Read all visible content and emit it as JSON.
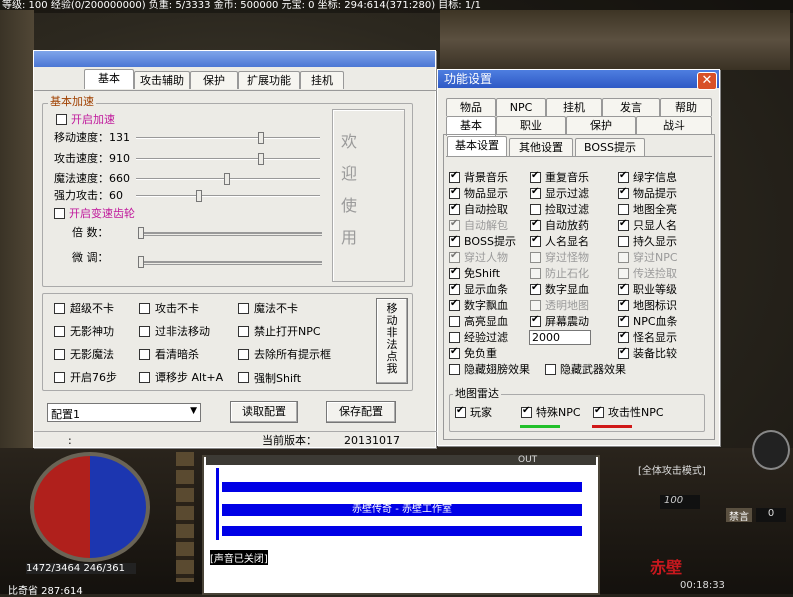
{
  "hud": {
    "status_line": "等级: 100 经验(0/200000000) 负重: 5/3333 金币: 500000 元宝: 0 坐标: 294:614(371:280) 目标: 1/1",
    "bottom_coords": "比奇省 287:614",
    "hp_mp": "1472/3464  246/361",
    "level": "100",
    "time": "00:18:33",
    "attack_mode": "[全体攻击模式]",
    "mode_btn": "禁言",
    "mode_val": "0",
    "brand": "赤壁",
    "tray": "OUT",
    "sound_msg": "[声音已关闭]",
    "chat_text": "赤壁传奇 - 赤壁工作室"
  },
  "left": {
    "tabs": [
      "基本",
      "攻击辅助",
      "保护",
      "扩展功能",
      "挂机"
    ],
    "speed_group": "基本加速",
    "enable_speed": "开启加速",
    "rows": [
      "移动速度：131",
      "攻击速度：910",
      "魔法速度：660",
      "强力攻击：60"
    ],
    "gear": "开启变速齿轮",
    "multiplier": "倍 数：",
    "finetune": "微 调：",
    "welcome": [
      "欢",
      "迎",
      "使",
      "用"
    ],
    "opts": [
      "超级不卡",
      "攻击不卡",
      "魔法不卡",
      "无影神功",
      "过非法移动",
      "禁止打开NPC",
      "无影魔法",
      "看清暗杀",
      "去除所有提示框",
      "开启76步",
      "谭移步 Alt+A",
      "强制Shift"
    ],
    "move_btn": [
      "移",
      "动",
      "非",
      "法",
      "点",
      "我"
    ],
    "config": "配置1",
    "read_btn": "读取配置",
    "save_btn": "保存配置",
    "status_colon": ":",
    "version_label": "当前版本：",
    "version": "20131017"
  },
  "right": {
    "title": "功能设置",
    "tabs_row1": [
      "物品",
      "NPC",
      "挂机",
      "发言",
      "帮助"
    ],
    "tabs_row2": [
      "基本",
      "职业",
      "保护",
      "战斗"
    ],
    "subtabs": [
      "基本设置",
      "其他设置",
      "BOSS提示"
    ],
    "col1": [
      "背景音乐",
      "物品显示",
      "自动捡取",
      "自动解包",
      "BOSS提示",
      "穿过人物",
      "免Shift",
      "显示血条",
      "数字飘血",
      "高亮显血",
      "经验过滤",
      "免负重"
    ],
    "col2": [
      "重复音乐",
      "显示过滤",
      "捡取过滤",
      "自动放药",
      "人名显名",
      "穿过怪物",
      "防止石化",
      "数字显血",
      "透明地图",
      "屏幕震动"
    ],
    "col3": [
      "绿字信息",
      "物品提示",
      "地图全亮",
      "只显人名",
      "持久显示",
      "穿过NPC",
      "传送捡取",
      "职业等级",
      "地图标识",
      "NPC血条",
      "怪名显示",
      "装备比较"
    ],
    "exp_value": "2000",
    "hide_wing": "隐藏翅膀效果",
    "hide_weapon": "隐藏武器效果",
    "radar": "地图雷达",
    "radar_items": [
      "玩家",
      "特殊NPC",
      "攻击性NPC"
    ],
    "colors": {
      "green": "#22c02a",
      "red": "#d01818"
    }
  }
}
